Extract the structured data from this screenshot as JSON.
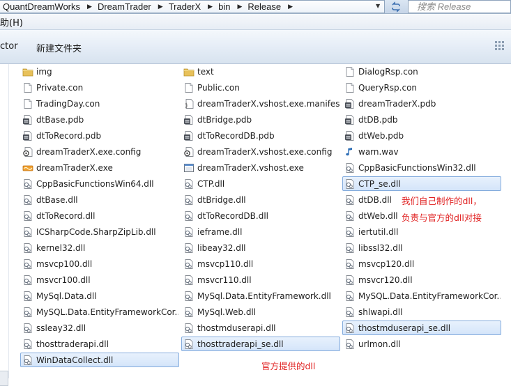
{
  "address": {
    "breadcrumb": [
      "QuantDreamWorks",
      "DreamTrader",
      "TraderX",
      "bin",
      "Release"
    ],
    "search_placeholder": "搜索 Release"
  },
  "menu": {
    "help_label": "助(H)"
  },
  "toolbar": {
    "connector_label": "ctor",
    "new_folder_label": "新建文件夹"
  },
  "files": [
    {
      "name": "img",
      "icon": "folder-icon",
      "col": 0,
      "row": 0
    },
    {
      "name": "text",
      "icon": "folder-icon",
      "col": 1,
      "row": 0
    },
    {
      "name": "DialogRsp.con",
      "icon": "file-icon",
      "col": 2,
      "row": 0
    },
    {
      "name": "Private.con",
      "icon": "file-icon",
      "col": 0,
      "row": 1
    },
    {
      "name": "Public.con",
      "icon": "file-icon",
      "col": 1,
      "row": 1
    },
    {
      "name": "QueryRsp.con",
      "icon": "file-icon",
      "col": 2,
      "row": 1
    },
    {
      "name": "TradingDay.con",
      "icon": "file-icon",
      "col": 0,
      "row": 2
    },
    {
      "name": "dreamTraderX.vshost.exe.manifest",
      "icon": "manifest-icon",
      "col": 1,
      "row": 2
    },
    {
      "name": "dreamTraderX.pdb",
      "icon": "pdb-icon",
      "col": 2,
      "row": 2
    },
    {
      "name": "dtBase.pdb",
      "icon": "pdb-icon",
      "col": 0,
      "row": 3
    },
    {
      "name": "dtBridge.pdb",
      "icon": "pdb-icon",
      "col": 1,
      "row": 3
    },
    {
      "name": "dtDB.pdb",
      "icon": "pdb-icon",
      "col": 2,
      "row": 3
    },
    {
      "name": "dtToRecord.pdb",
      "icon": "pdb-icon",
      "col": 0,
      "row": 4
    },
    {
      "name": "dtToRecordDB.pdb",
      "icon": "pdb-icon",
      "col": 1,
      "row": 4
    },
    {
      "name": "dtWeb.pdb",
      "icon": "pdb-icon",
      "col": 2,
      "row": 4
    },
    {
      "name": "dreamTraderX.exe.config",
      "icon": "config-icon",
      "col": 0,
      "row": 5
    },
    {
      "name": "dreamTraderX.vshost.exe.config",
      "icon": "config-icon",
      "col": 1,
      "row": 5
    },
    {
      "name": "warn.wav",
      "icon": "audio-icon",
      "col": 2,
      "row": 5
    },
    {
      "name": "dreamTraderX.exe",
      "icon": "app-exe-icon",
      "col": 0,
      "row": 6
    },
    {
      "name": "dreamTraderX.vshost.exe",
      "icon": "exe-icon",
      "col": 1,
      "row": 6
    },
    {
      "name": "CppBasicFunctionsWin32.dll",
      "icon": "dll-icon",
      "col": 2,
      "row": 6
    },
    {
      "name": "CppBasicFunctionsWin64.dll",
      "icon": "dll-icon",
      "col": 0,
      "row": 7
    },
    {
      "name": "CTP.dll",
      "icon": "dll-icon",
      "col": 1,
      "row": 7
    },
    {
      "name": "CTP_se.dll",
      "icon": "dll-icon",
      "col": 2,
      "row": 7,
      "selected": true
    },
    {
      "name": "dtBase.dll",
      "icon": "dll-icon",
      "col": 0,
      "row": 8
    },
    {
      "name": "dtBridge.dll",
      "icon": "dll-icon",
      "col": 1,
      "row": 8
    },
    {
      "name": "dtDB.dll",
      "icon": "dll-icon",
      "col": 2,
      "row": 8
    },
    {
      "name": "dtToRecord.dll",
      "icon": "dll-icon",
      "col": 0,
      "row": 9
    },
    {
      "name": "dtToRecordDB.dll",
      "icon": "dll-icon",
      "col": 1,
      "row": 9
    },
    {
      "name": "dtWeb.dll",
      "icon": "dll-icon",
      "col": 2,
      "row": 9
    },
    {
      "name": "ICSharpCode.SharpZipLib.dll",
      "icon": "dll-icon",
      "col": 0,
      "row": 10
    },
    {
      "name": "ieframe.dll",
      "icon": "dll-icon",
      "col": 1,
      "row": 10
    },
    {
      "name": "iertutil.dll",
      "icon": "dll-icon",
      "col": 2,
      "row": 10
    },
    {
      "name": "kernel32.dll",
      "icon": "dll-icon",
      "col": 0,
      "row": 11
    },
    {
      "name": "libeay32.dll",
      "icon": "dll-icon",
      "col": 1,
      "row": 11
    },
    {
      "name": "libssl32.dll",
      "icon": "dll-icon",
      "col": 2,
      "row": 11
    },
    {
      "name": "msvcp100.dll",
      "icon": "dll-icon",
      "col": 0,
      "row": 12
    },
    {
      "name": "msvcp110.dll",
      "icon": "dll-icon",
      "col": 1,
      "row": 12
    },
    {
      "name": "msvcp120.dll",
      "icon": "dll-icon",
      "col": 2,
      "row": 12
    },
    {
      "name": "msvcr100.dll",
      "icon": "dll-icon",
      "col": 0,
      "row": 13
    },
    {
      "name": "msvcr110.dll",
      "icon": "dll-icon",
      "col": 1,
      "row": 13
    },
    {
      "name": "msvcr120.dll",
      "icon": "dll-icon",
      "col": 2,
      "row": 13
    },
    {
      "name": "MySql.Data.dll",
      "icon": "dll-icon",
      "col": 0,
      "row": 14
    },
    {
      "name": "MySql.Data.EntityFramework.dll",
      "icon": "dll-icon",
      "col": 1,
      "row": 14
    },
    {
      "name": "MySQL.Data.EntityFrameworkCor...",
      "icon": "dll-icon",
      "col": 2,
      "row": 14
    },
    {
      "name": "MySQL.Data.EntityFrameworkCor...",
      "icon": "dll-icon",
      "col": 0,
      "row": 15
    },
    {
      "name": "MySql.Web.dll",
      "icon": "dll-icon",
      "col": 1,
      "row": 15
    },
    {
      "name": "shlwapi.dll",
      "icon": "dll-icon",
      "col": 2,
      "row": 15
    },
    {
      "name": "ssleay32.dll",
      "icon": "dll-icon",
      "col": 0,
      "row": 16
    },
    {
      "name": "thostmduserapi.dll",
      "icon": "dll-icon",
      "col": 1,
      "row": 16
    },
    {
      "name": "thostmduserapi_se.dll",
      "icon": "dll-icon",
      "col": 2,
      "row": 16,
      "selected": true
    },
    {
      "name": "thosttraderapi.dll",
      "icon": "dll-icon",
      "col": 0,
      "row": 17
    },
    {
      "name": "thosttraderapi_se.dll",
      "icon": "dll-icon",
      "col": 1,
      "row": 17,
      "selected": true
    },
    {
      "name": "urlmon.dll",
      "icon": "dll-icon",
      "col": 2,
      "row": 17
    },
    {
      "name": "WinDataCollect.dll",
      "icon": "dll-icon",
      "col": 0,
      "row": 18,
      "selected": true
    }
  ],
  "annotations": {
    "own_dll_line1": "我们自己制作的dll，",
    "own_dll_line2": "负责与官方的dll对接",
    "official_dll": "官方提供的dll"
  },
  "colors": {
    "annotation": "#e02020",
    "selection_border": "#84acdd",
    "selection_fill": "#d4e5fa"
  }
}
